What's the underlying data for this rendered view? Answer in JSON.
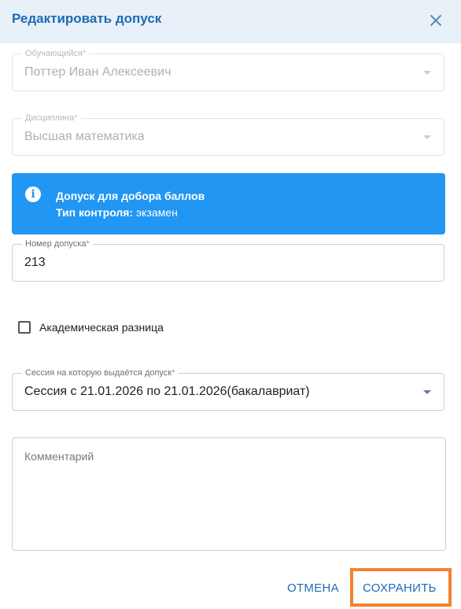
{
  "dialog": {
    "title": "Редактировать допуск",
    "close_icon": "close-icon"
  },
  "fields": {
    "student": {
      "label": "Обучающийся",
      "required_mark": "*",
      "value": "Поттер Иван Алексеевич",
      "disabled": true
    },
    "discipline": {
      "label": "Дисциплина",
      "required_mark": "*",
      "value": "Высшая математика",
      "disabled": true
    },
    "permit_number": {
      "label": "Номер допуска",
      "required_mark": "*",
      "value": "213"
    },
    "session": {
      "label": "Сессия на которую выдаётся допуск",
      "required_mark": "*",
      "value": "Сессия с 21.01.2026 по 21.01.2026(бакалавриат)"
    },
    "comment": {
      "placeholder": "Комментарий",
      "value": ""
    }
  },
  "alert": {
    "icon": "info-icon",
    "line1": "Допуск для добора баллов",
    "control_label": "Тип контроля:",
    "control_value": "экзамен",
    "color": "#2196f3"
  },
  "checkbox": {
    "label": "Академическая разница",
    "checked": false
  },
  "actions": {
    "cancel_label": "ОТМЕНА",
    "save_label": "СОХРАНИТЬ"
  },
  "colors": {
    "accent": "#1c6ab4",
    "header_bg": "#e8f0f8",
    "highlight": "#f4812f"
  }
}
